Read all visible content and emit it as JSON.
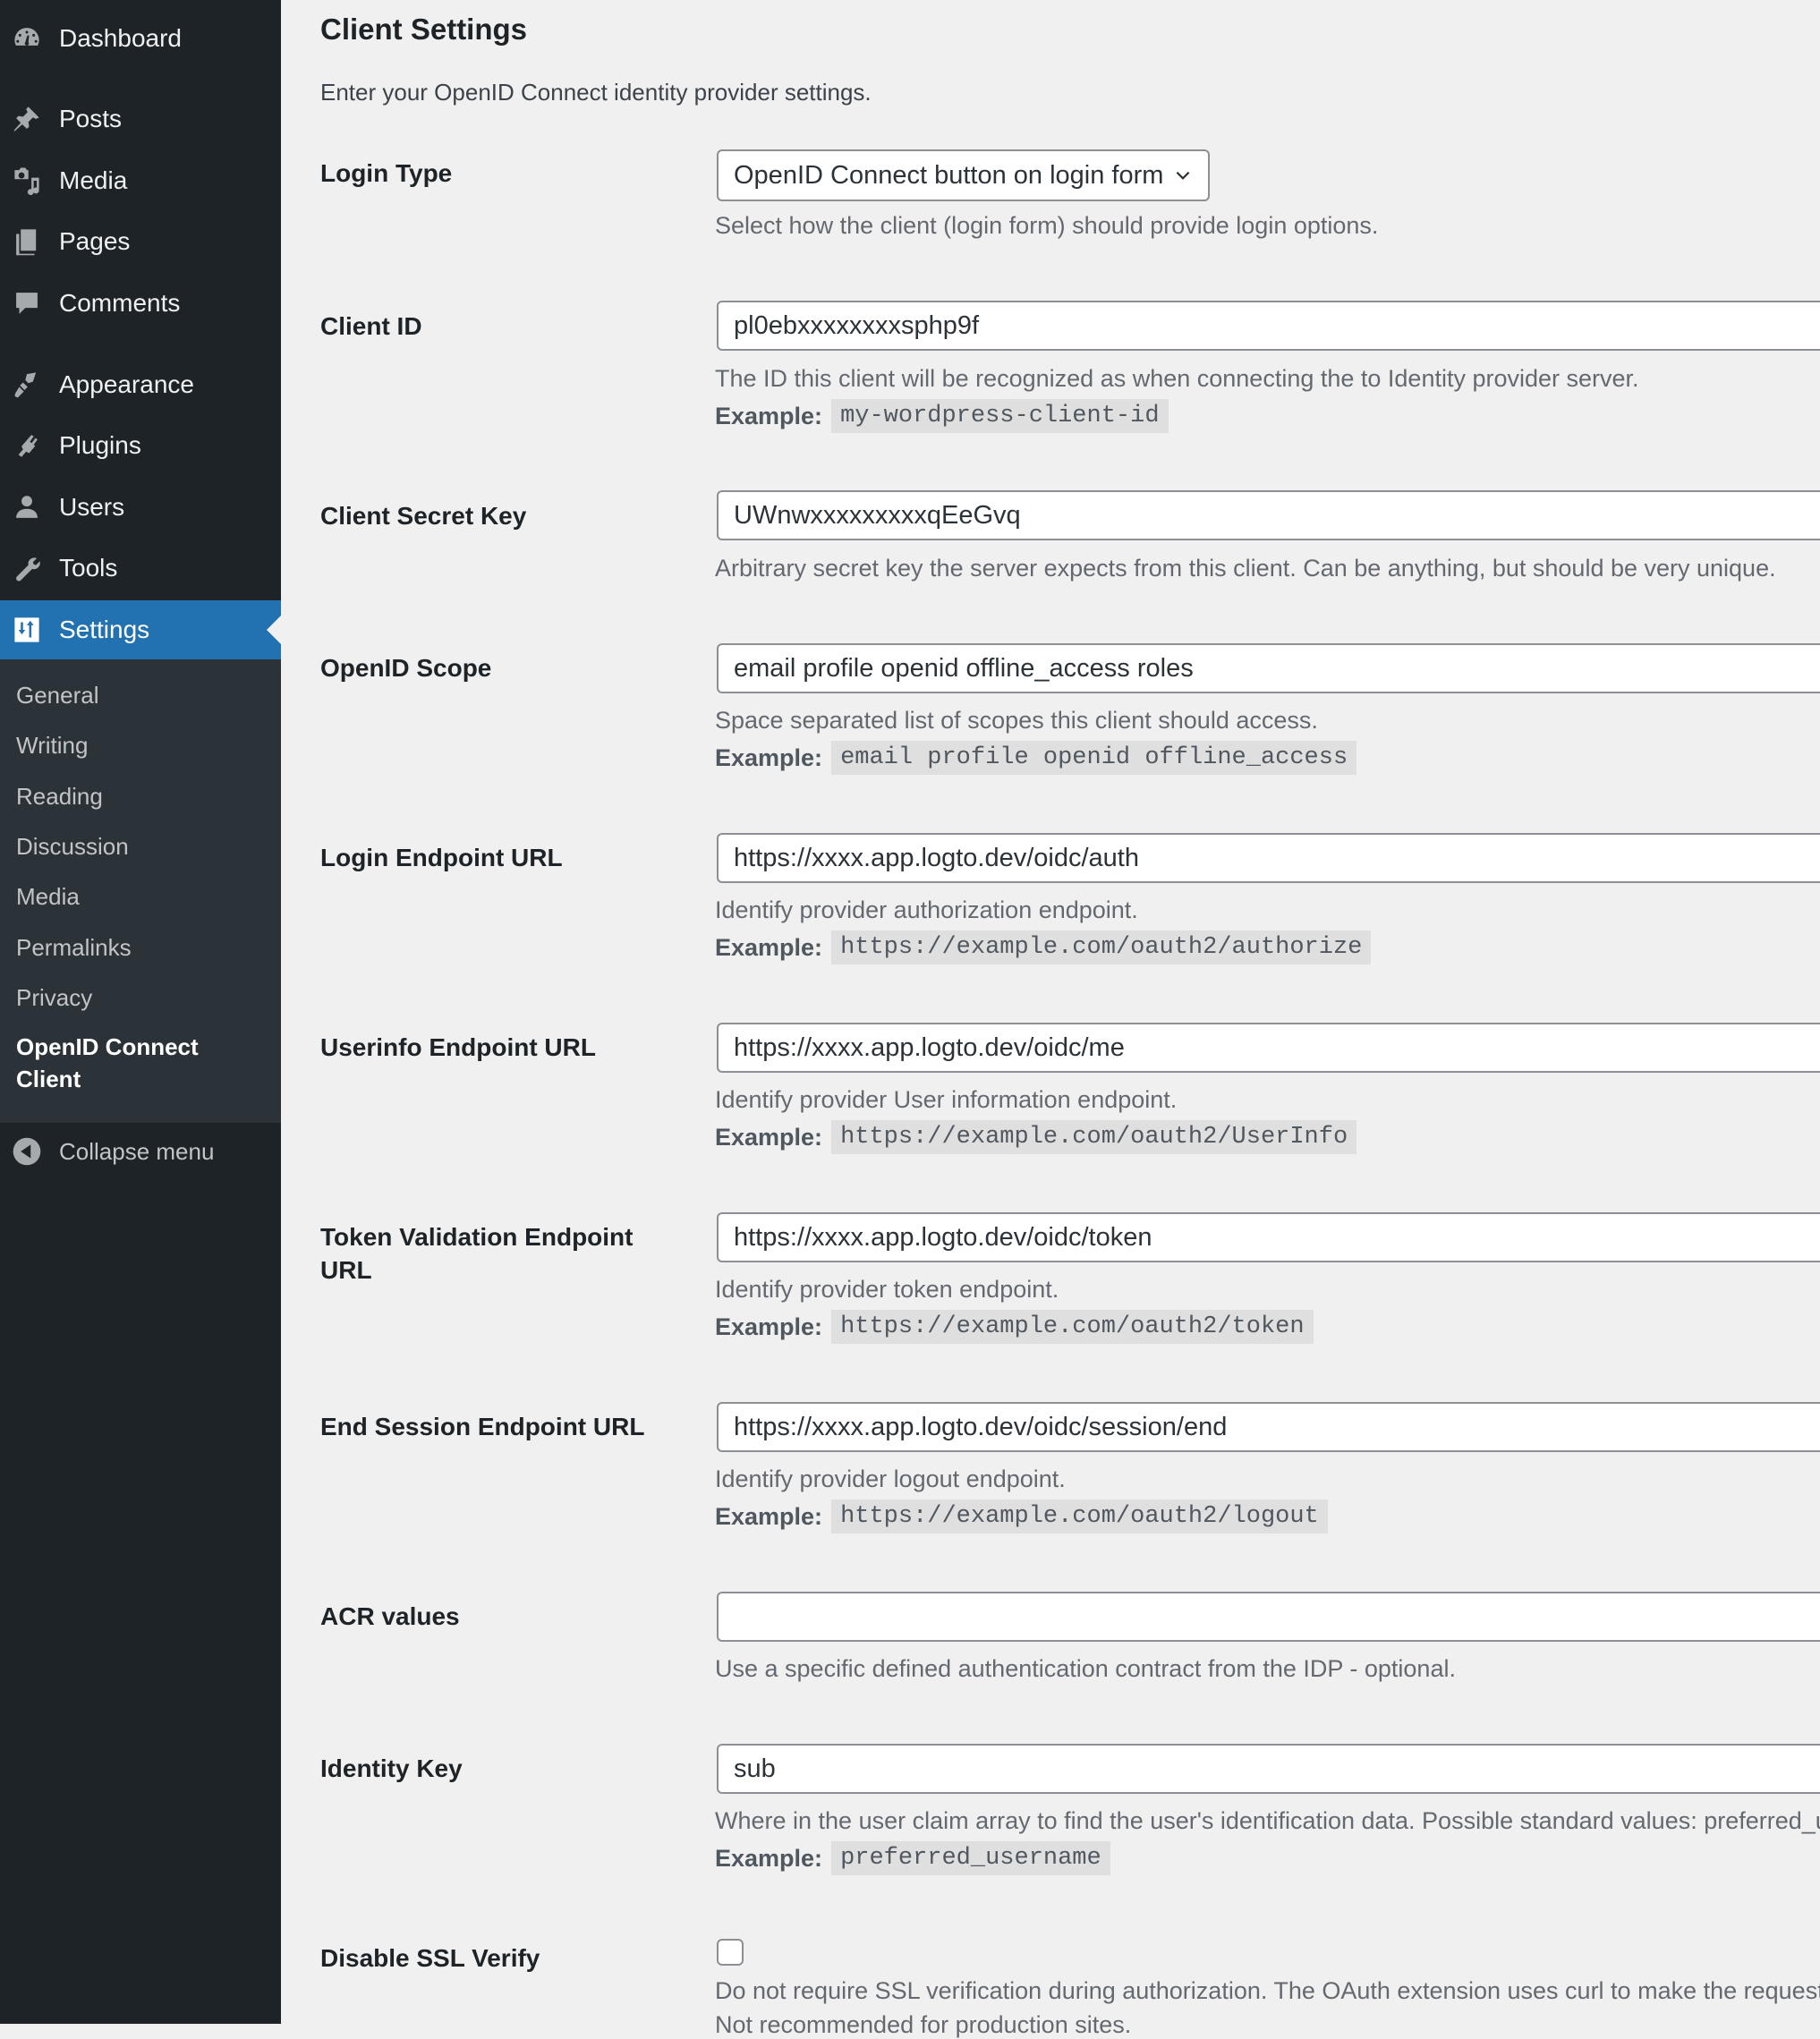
{
  "sidebar": {
    "top_items": [
      {
        "label": "Dashboard",
        "icon": "dashboard-icon"
      },
      {
        "label": "Posts",
        "icon": "pushpin-icon"
      },
      {
        "label": "Media",
        "icon": "media-icon"
      },
      {
        "label": "Pages",
        "icon": "pages-icon"
      },
      {
        "label": "Comments",
        "icon": "comment-icon"
      },
      {
        "label": "Appearance",
        "icon": "paintbrush-icon"
      },
      {
        "label": "Plugins",
        "icon": "plugin-icon"
      },
      {
        "label": "Users",
        "icon": "user-icon"
      },
      {
        "label": "Tools",
        "icon": "wrench-icon"
      },
      {
        "label": "Settings",
        "icon": "settings-icon",
        "active": true
      }
    ],
    "submenu": [
      {
        "label": "General"
      },
      {
        "label": "Writing"
      },
      {
        "label": "Reading"
      },
      {
        "label": "Discussion"
      },
      {
        "label": "Media"
      },
      {
        "label": "Permalinks"
      },
      {
        "label": "Privacy"
      },
      {
        "label": "OpenID Connect Client",
        "current": true
      }
    ],
    "collapse_label": "Collapse menu",
    "colors": {
      "background": "#1d2327",
      "submenu_background": "#2c3338",
      "active": "#2271b1"
    }
  },
  "main": {
    "title": "Client Settings",
    "description": "Enter your OpenID Connect identity provider settings.",
    "example_label": "Example:",
    "fields": {
      "login_type": {
        "label": "Login Type",
        "selected": "OpenID Connect button on login form",
        "help": "Select how the client (login form) should provide login options."
      },
      "client_id": {
        "label": "Client ID",
        "value": "pl0ebxxxxxxxxsphp9f",
        "help": "The ID this client will be recognized as when connecting the to Identity provider server.",
        "example": "my-wordpress-client-id"
      },
      "client_secret": {
        "label": "Client Secret Key",
        "value": "UWnwxxxxxxxxxqEeGvq",
        "help": "Arbitrary secret key the server expects from this client. Can be anything, but should be very unique."
      },
      "scope": {
        "label": "OpenID Scope",
        "value": "email profile openid offline_access roles",
        "help": "Space separated list of scopes this client should access.",
        "example": "email profile openid offline_access"
      },
      "login_endpoint": {
        "label": "Login Endpoint URL",
        "value": "https://xxxx.app.logto.dev/oidc/auth",
        "help": "Identify provider authorization endpoint.",
        "example": "https://example.com/oauth2/authorize"
      },
      "userinfo_endpoint": {
        "label": "Userinfo Endpoint URL",
        "value": "https://xxxx.app.logto.dev/oidc/me",
        "help": "Identify provider User information endpoint.",
        "example": "https://example.com/oauth2/UserInfo"
      },
      "token_endpoint": {
        "label": "Token Validation Endpoint URL",
        "value": "https://xxxx.app.logto.dev/oidc/token",
        "help": "Identify provider token endpoint.",
        "example": "https://example.com/oauth2/token"
      },
      "end_session_endpoint": {
        "label": "End Session Endpoint URL",
        "value": "https://xxxx.app.logto.dev/oidc/session/end",
        "help": "Identify provider logout endpoint.",
        "example": "https://example.com/oauth2/logout"
      },
      "acr_values": {
        "label": "ACR values",
        "value": "",
        "help": "Use a specific defined authentication contract from the IDP - optional."
      },
      "identity_key": {
        "label": "Identity Key",
        "value": "sub",
        "help": "Where in the user claim array to find the user's identification data. Possible standard values: preferred_username",
        "example": "preferred_username"
      },
      "disable_ssl_verify": {
        "label": "Disable SSL Verify",
        "checked": false,
        "help": "Do not require SSL verification during authorization. The OAuth extension uses curl to make the request.",
        "help2": "Not recommended for production sites."
      }
    }
  }
}
